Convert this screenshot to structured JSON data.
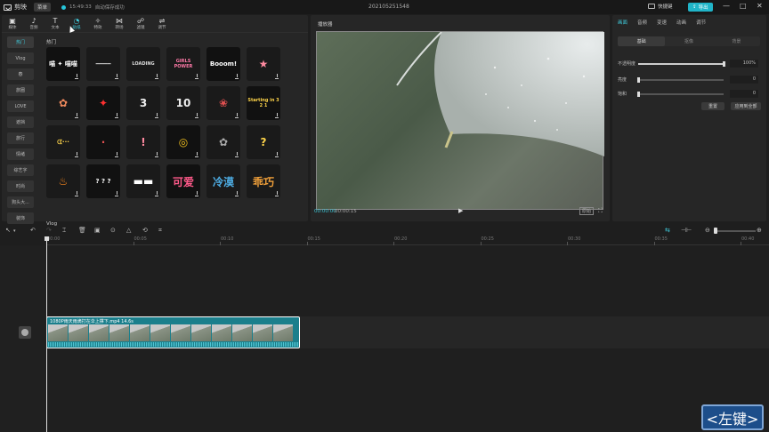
{
  "app": {
    "name": "剪映",
    "menu": "菜单",
    "save_time": "15:49:33",
    "save_status": "自动保存成功",
    "project_title": "202105251548",
    "shortcut": "快捷键",
    "export": "导出",
    "win_min": "—",
    "win_max": "□",
    "win_close": "✕"
  },
  "library": {
    "tabs": [
      {
        "label": "媒体",
        "icon": "▣"
      },
      {
        "label": "音频",
        "icon": "♪"
      },
      {
        "label": "文本",
        "icon": "T"
      },
      {
        "label": "贴纸",
        "icon": "◔"
      },
      {
        "label": "特效",
        "icon": "✧"
      },
      {
        "label": "转场",
        "icon": "⋈"
      },
      {
        "label": "滤镜",
        "icon": "☍"
      },
      {
        "label": "调节",
        "icon": "⇌"
      }
    ],
    "categories": [
      "热门",
      "Vlog",
      "春",
      "旅圈",
      "LOVE",
      "遮挡",
      "旅行",
      "情绪",
      "综艺字",
      "时尚",
      "狗头大...",
      "装饰"
    ],
    "section_hot": "热门",
    "section_vlog": "Vlog",
    "stickers": [
      {
        "text": "喵 ✦ 喵喵",
        "color": "#ffffff",
        "bg": "#111"
      },
      {
        "text": "━━━━",
        "color": "#bbbbbb",
        "bg": "#1a1a1a"
      },
      {
        "text": "LOADING",
        "color": "#dddddd",
        "bg": "#1a1a1a"
      },
      {
        "text": "GIRLS POWER",
        "color": "#ff7aa8",
        "bg": "#1a1a1a"
      },
      {
        "text": "Booom!",
        "color": "#ffffff",
        "bg": "#111"
      },
      {
        "text": "★",
        "color": "#ff8aa0",
        "bg": "#1a1a1a"
      },
      {
        "text": "✿",
        "color": "#f08a5d",
        "bg": "#1a1a1a"
      },
      {
        "text": "✦",
        "color": "#ff3030",
        "bg": "#111"
      },
      {
        "text": "3",
        "color": "#eeeeee",
        "bg": "#1a1a1a"
      },
      {
        "text": "10",
        "color": "#eeeeee",
        "bg": "#1a1a1a"
      },
      {
        "text": "❀",
        "color": "#e05050",
        "bg": "#1a1a1a"
      },
      {
        "text": "Starting in 3 2 1",
        "color": "#ffd54a",
        "bg": "#111"
      },
      {
        "text": "ᗧ···",
        "color": "#ffd54a",
        "bg": "#1a1a1a"
      },
      {
        "text": "·",
        "color": "#e05050",
        "bg": "#111"
      },
      {
        "text": "!",
        "color": "#ff8aa0",
        "bg": "#1a1a1a"
      },
      {
        "text": "◎",
        "color": "#f2c01e",
        "bg": "#111"
      },
      {
        "text": "✿",
        "color": "#aaaaaa",
        "bg": "#1a1a1a"
      },
      {
        "text": "?",
        "color": "#ffd54a",
        "bg": "#1a1a1a"
      },
      {
        "text": "♨",
        "color": "#ff8a1e",
        "bg": "#1a1a1a"
      },
      {
        "text": "? ? ?",
        "color": "#ffffff",
        "bg": "#111"
      },
      {
        "text": "▬▬",
        "color": "#ffffff",
        "bg": "#1a1a1a"
      },
      {
        "text": "可爱",
        "color": "#ff5a8a",
        "bg": "#111"
      },
      {
        "text": "冷漠",
        "color": "#4fb0e8",
        "bg": "#1a1a1a"
      },
      {
        "text": "乖巧",
        "color": "#f0a03a",
        "bg": "#1a1a1a"
      }
    ]
  },
  "player": {
    "title": "播放器",
    "time_current": "00:00:00",
    "time_total": "00:00:15",
    "play": "▶",
    "ratio": "原始",
    "fullscreen": "⛶"
  },
  "inspector": {
    "tabs": [
      "画面",
      "音频",
      "变速",
      "动画",
      "调节"
    ],
    "sub_tabs": [
      "基础",
      "抠像",
      "背景"
    ],
    "props": [
      {
        "label": "不透明度",
        "value": "100%",
        "level": 1.0
      },
      {
        "label": "亮度",
        "value": "0",
        "level": 0.0
      },
      {
        "label": "饱和",
        "value": "0",
        "level": 0.0
      }
    ],
    "reset": "重置",
    "apply_all": "应用到全部"
  },
  "timeline": {
    "ticks": [
      "00:00",
      "00:05",
      "00:10",
      "00:15",
      "00:20",
      "00:25",
      "00:30",
      "00:35",
      "00:40"
    ],
    "clip_name": "1080P雨天雨滴打在伞上撑下.mp4",
    "clip_duration": "14.6s",
    "frame_count": 12
  },
  "key_hint": "<左键>"
}
